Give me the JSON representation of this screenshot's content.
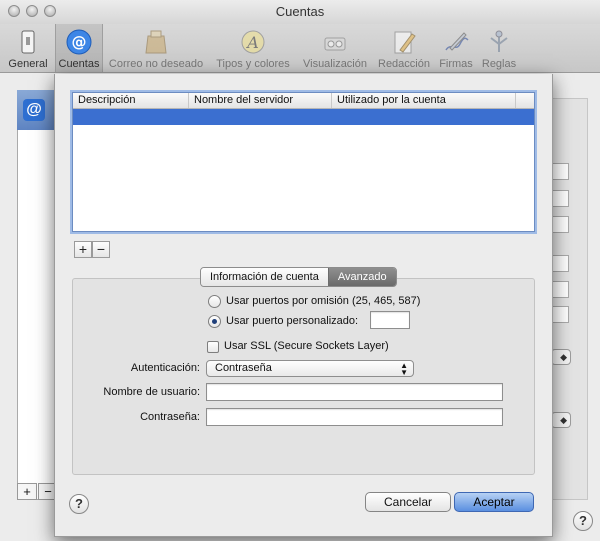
{
  "window": {
    "title": "Cuentas"
  },
  "toolbar": {
    "items": [
      {
        "label": "General",
        "icon": "phone-switch-icon"
      },
      {
        "label": "Cuentas",
        "icon": "at-sign-icon"
      },
      {
        "label": "Correo no deseado",
        "icon": "junk-bag-icon"
      },
      {
        "label": "Tipos y colores",
        "icon": "font-palette-icon"
      },
      {
        "label": "Visualización",
        "icon": "glasses-icon"
      },
      {
        "label": "Redacción",
        "icon": "pencil-paper-icon"
      },
      {
        "label": "Firmas",
        "icon": "pen-signature-icon"
      },
      {
        "label": "Reglas",
        "icon": "rules-icon"
      }
    ]
  },
  "table": {
    "columns": [
      "Descripción",
      "Nombre del servidor",
      "Utilizado por la cuenta"
    ]
  },
  "list_buttons": {
    "add": "+",
    "remove": "−"
  },
  "tabs": {
    "info": "Información de cuenta",
    "advanced": "Avanzado"
  },
  "advanced": {
    "radio_default_ports": "Usar puertos por omisión (25, 465, 587)",
    "radio_custom_port": "Usar puerto personalizado:",
    "custom_port_value": "",
    "ssl_label": "Usar SSL (Secure Sockets Layer)",
    "auth_label": "Autenticación:",
    "auth_value": "Contraseña",
    "username_label": "Nombre de usuario:",
    "username_value": "",
    "password_label": "Contraseña:",
    "password_value": ""
  },
  "buttons": {
    "help": "?",
    "cancel": "Cancelar",
    "accept": "Aceptar"
  },
  "colors": {
    "selection": "#3b6fd0",
    "default_button": "#5a8fe0"
  }
}
